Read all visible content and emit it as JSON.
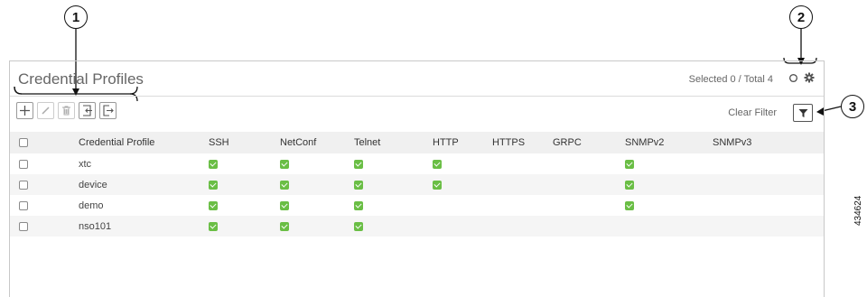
{
  "callouts": [
    "1",
    "2",
    "3"
  ],
  "panel": {
    "title": "Credential Profiles",
    "selection_info": "Selected 0 / Total 4",
    "clear_filter_label": "Clear Filter"
  },
  "toolbar": {
    "buttons": [
      "add-icon",
      "edit-icon",
      "delete-icon",
      "import-icon",
      "export-icon"
    ]
  },
  "table": {
    "columns": [
      "",
      "Credential Profile",
      "SSH",
      "NetConf",
      "Telnet",
      "HTTP",
      "HTTPS",
      "GRPC",
      "SNMPv2",
      "SNMPv3"
    ],
    "rows": [
      {
        "name": "xtc",
        "ssh": true,
        "netconf": true,
        "telnet": true,
        "http": true,
        "https": false,
        "grpc": false,
        "snmpv2": true,
        "snmpv3": false
      },
      {
        "name": "device",
        "ssh": true,
        "netconf": true,
        "telnet": true,
        "http": true,
        "https": false,
        "grpc": false,
        "snmpv2": true,
        "snmpv3": false
      },
      {
        "name": "demo",
        "ssh": true,
        "netconf": true,
        "telnet": true,
        "http": false,
        "https": false,
        "grpc": false,
        "snmpv2": true,
        "snmpv3": false
      },
      {
        "name": "nso101",
        "ssh": true,
        "netconf": true,
        "telnet": true,
        "http": false,
        "https": false,
        "grpc": false,
        "snmpv2": false,
        "snmpv3": false
      }
    ]
  },
  "figure_id": "434624",
  "colors": {
    "check": "#6abe45",
    "header_bg": "#f0f0f0",
    "alt_row_bg": "#f5f5f5"
  }
}
